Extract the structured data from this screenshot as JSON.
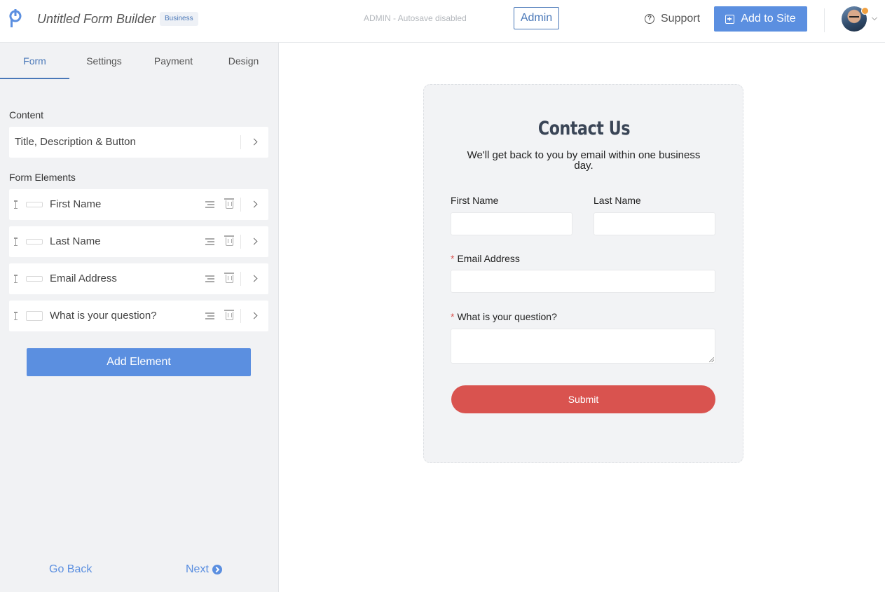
{
  "header": {
    "app_title": "Untitled Form Builder",
    "plan_badge": "Business",
    "autosave_status": "ADMIN - Autosave disabled",
    "admin_label": "Admin",
    "support_label": "Support",
    "add_to_site_label": "Add to Site"
  },
  "sidebar": {
    "tabs": [
      {
        "label": "Form",
        "active": true
      },
      {
        "label": "Settings",
        "active": false
      },
      {
        "label": "Payment",
        "active": false
      },
      {
        "label": "Design",
        "active": false
      }
    ],
    "content_label": "Content",
    "content_item": "Title, Description & Button",
    "form_elements_label": "Form Elements",
    "elements": [
      {
        "label": "First Name",
        "icon": "text-field-icon"
      },
      {
        "label": "Last Name",
        "icon": "text-field-icon"
      },
      {
        "label": "Email Address",
        "icon": "email-field-icon"
      },
      {
        "label": "What is your question?",
        "icon": "textarea-field-icon"
      }
    ],
    "add_element_label": "Add Element",
    "go_back_label": "Go Back",
    "next_label": "Next"
  },
  "form": {
    "title": "Contact Us",
    "description": "We'll get back to you by email within one business day.",
    "first_name_label": "First Name",
    "last_name_label": "Last Name",
    "required_mark": "*",
    "email_label": "Email Address",
    "question_label": "What is your question?",
    "submit_label": "Submit"
  },
  "colors": {
    "accent": "#5b8fe0",
    "submit": "#d9534f",
    "required": "#d9534f"
  }
}
